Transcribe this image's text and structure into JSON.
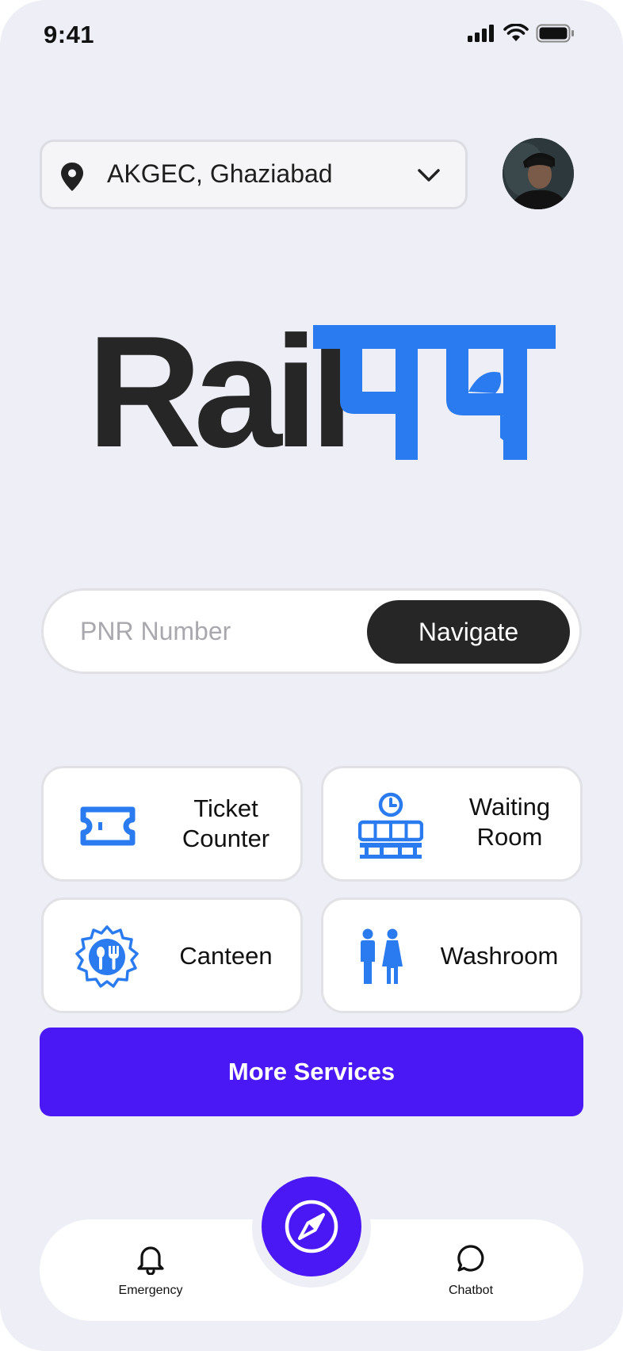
{
  "status_bar": {
    "time": "9:41"
  },
  "location": {
    "selected": "AKGEC, Ghaziabad"
  },
  "logo": {
    "latin": "Rail",
    "devanagari": "पथ",
    "colors": {
      "latin": "#262626",
      "devanagari": "#2B7BF0"
    }
  },
  "pnr_search": {
    "placeholder": "PNR Number",
    "value": "",
    "button_label": "Navigate"
  },
  "services": [
    {
      "label_line1": "Ticket",
      "label_line2": "Counter",
      "icon": "ticket-icon"
    },
    {
      "label_line1": "Waiting",
      "label_line2": "Room",
      "icon": "waiting-room-icon"
    },
    {
      "label_line1": "Canteen",
      "label_line2": "",
      "icon": "canteen-icon"
    },
    {
      "label_line1": "Washroom",
      "label_line2": "",
      "icon": "washroom-icon"
    }
  ],
  "more_services": {
    "label": "More Services"
  },
  "bottom_nav": {
    "items": [
      {
        "label": "Emergency",
        "icon": "bell-icon"
      },
      {
        "label": "Chatbot",
        "icon": "chat-bubble-icon"
      }
    ],
    "center_icon": "compass-icon"
  },
  "colors": {
    "accent_blue": "#2B7BF0",
    "primary_purple": "#4A18F5",
    "background": "#EEEEF7",
    "dark": "#262626"
  }
}
